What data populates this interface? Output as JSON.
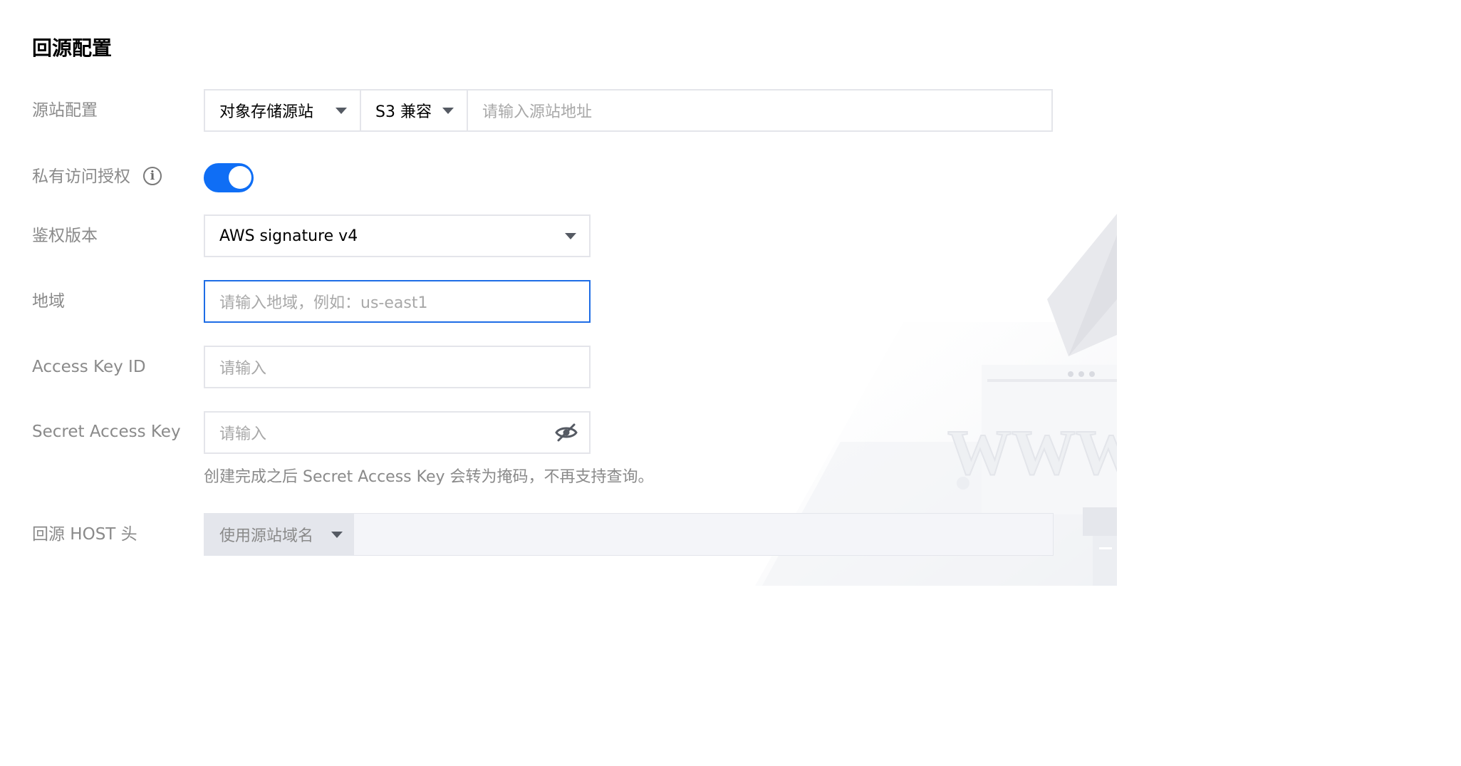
{
  "page": {
    "title": "回源配置"
  },
  "origin_config": {
    "label": "源站配置",
    "origin_type": "对象存储源站",
    "compat_type": "S3 兼容",
    "address_placeholder": "请输入源站地址"
  },
  "private_access": {
    "label": "私有访问授权",
    "info_icon": "info-icon",
    "enabled": true
  },
  "auth_version": {
    "label": "鉴权版本",
    "value": "AWS signature v4"
  },
  "region": {
    "label": "地域",
    "placeholder": "请输入地域，例如：us-east1"
  },
  "access_key_id": {
    "label": "Access Key ID",
    "placeholder": "请输入"
  },
  "secret_access_key": {
    "label": "Secret Access Key",
    "placeholder": "请输入",
    "visibility_icon": "eye-off-icon",
    "help_text": "创建完成之后 Secret Access Key 会转为掩码，不再支持查询。"
  },
  "origin_host": {
    "label": "回源 HOST 头",
    "value": "使用源站域名"
  },
  "colors": {
    "primary": "#0f6ef5",
    "focus_border": "#1e6de6",
    "label_text": "#8a8a8a",
    "border": "#e4e5ea"
  }
}
